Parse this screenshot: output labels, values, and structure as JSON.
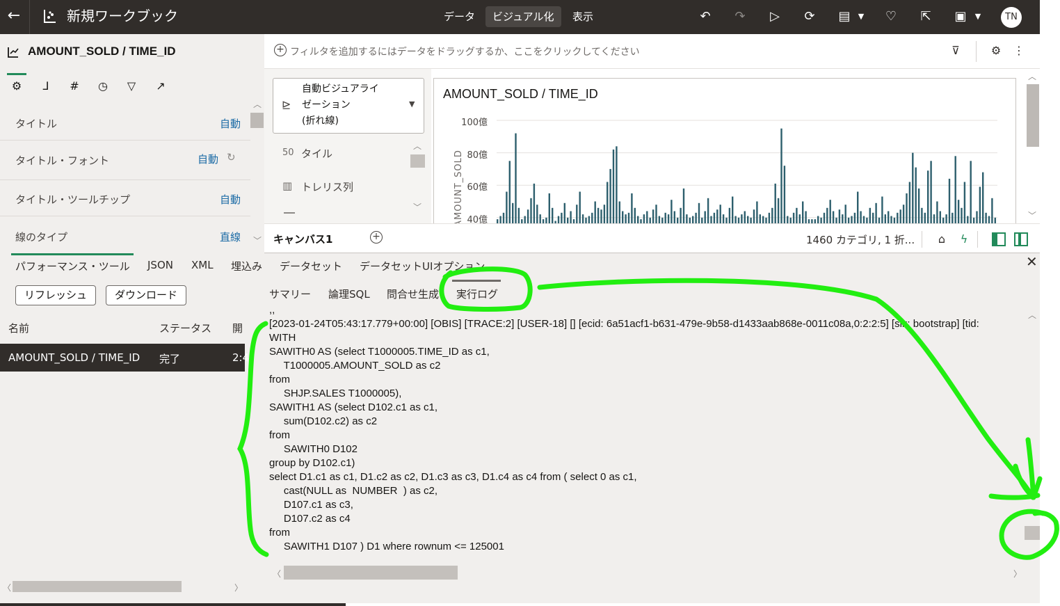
{
  "header": {
    "back_icon": "back-arrow-icon",
    "workbook_title": "新規ワークブック",
    "tabs": [
      {
        "label": "データ",
        "active": false
      },
      {
        "label": "ビジュアル化",
        "active": true
      },
      {
        "label": "表示",
        "active": false
      }
    ],
    "avatar_initials": "TN"
  },
  "properties": {
    "viz_title": "AMOUNT_SOLD / TIME_ID",
    "rows": [
      {
        "label": "タイトル",
        "value": "自動"
      },
      {
        "label": "タイトル・フォント",
        "value": "自動"
      },
      {
        "label": "タイトル・ツールチップ",
        "value": "自動"
      },
      {
        "label": "線のタイプ",
        "value": "直線"
      }
    ]
  },
  "filterbar": {
    "hint": "フィルタを追加するにはデータをドラッグするか、ここをクリックしてください"
  },
  "grammar": {
    "viz_type_line1": "自動ビジュアライ",
    "viz_type_line2": "ゼーション",
    "viz_type_line3": "(折れ線)",
    "items": [
      {
        "icon_text": "50",
        "label": "タイル"
      },
      {
        "icon_text": "▥",
        "label": "トレリス列"
      }
    ]
  },
  "chart_data": {
    "type": "bar",
    "title": "AMOUNT_SOLD / TIME_ID",
    "ylabel": "AMOUNT_SOLD",
    "y_ticks": [
      "100億",
      "80億",
      "60億",
      "40億"
    ],
    "y_tick_values": [
      10000000000,
      8000000000,
      6000000000,
      4000000000
    ],
    "ylim_visible": [
      3700000000,
      10600000000
    ],
    "color": "#2d5f6d",
    "values_billion": [
      3.9,
      4.1,
      4.3,
      5.6,
      7.5,
      4.9,
      9.2,
      4.6,
      3.9,
      4.1,
      4.5,
      5.2,
      6.1,
      4.8,
      4.2,
      3.9,
      4.0,
      5.5,
      4.6,
      3.8,
      4.1,
      4.3,
      4.9,
      4.0,
      4.4,
      3.9,
      4.8,
      5.6,
      4.2,
      4.0,
      4.1,
      4.3,
      5.0,
      4.6,
      4.5,
      4.8,
      6.2,
      7.0,
      8.2,
      8.4,
      5.0,
      4.4,
      4.2,
      4.3,
      5.5,
      4.6,
      4.1,
      3.9,
      4.2,
      4.4,
      4.0,
      4.5,
      4.8,
      4.1,
      4.0,
      4.3,
      4.2,
      5.1,
      4.4,
      4.0,
      4.6,
      5.8,
      4.2,
      4.0,
      4.1,
      4.3,
      4.9,
      4.0,
      4.4,
      5.2,
      4.1,
      4.3,
      4.5,
      4.8,
      4.2,
      4.0,
      4.6,
      5.3,
      4.1,
      4.0,
      4.2,
      4.4,
      4.1,
      4.0,
      4.5,
      5.0,
      4.2,
      4.1,
      4.0,
      4.3,
      4.6,
      6.1,
      5.2,
      9.5,
      7.2,
      4.1,
      4.0,
      4.3,
      4.6,
      4.2,
      5.0,
      4.4,
      3.9,
      3.9,
      3.9,
      4.1,
      4.0,
      4.3,
      4.6,
      5.1,
      4.4,
      4.0,
      4.5,
      4.2,
      4.8,
      4.0,
      4.1,
      4.3,
      5.6,
      4.4,
      4.1,
      4.0,
      4.6,
      4.3,
      4.9,
      4.0,
      5.3,
      4.2,
      4.4,
      4.1,
      4.0,
      4.3,
      4.5,
      4.8,
      5.5,
      6.2,
      8.0,
      7.1,
      5.8,
      4.6,
      4.3,
      6.9,
      7.5,
      4.2,
      5.0,
      4.4,
      4.0,
      4.2,
      6.4,
      4.3,
      7.8,
      5.1,
      4.6,
      6.2,
      4.1,
      7.5,
      4.0,
      4.4,
      5.9,
      6.8,
      4.3,
      4.1,
      5.2,
      4.0
    ]
  },
  "canvasbar": {
    "canvas_tab": "キャンバス1",
    "status": "1460 カテゴリ, 1 折..."
  },
  "bottom": {
    "tabs": [
      "パフォーマンス・ツール",
      "JSON",
      "XML",
      "埋込み",
      "データセット",
      "データセットUIオプション"
    ],
    "refresh_label": "リフレッシュ",
    "download_label": "ダウンロード",
    "columns": [
      "名前",
      "ステータス",
      "開"
    ],
    "row": {
      "name": "AMOUNT_SOLD / TIME_ID",
      "status": "完了",
      "start": "2:4"
    },
    "subtabs": [
      "サマリー",
      "論理SQL",
      "問合せ生成",
      "実行ログ"
    ],
    "log_lines": [
      ",,",
      "[2023-01-24T05:43:17.779+00:00] [OBIS] [TRACE:2] [USER-18] [] [ecid: 6a51acf1-b631-479e-9b58-d1433aab868e-0011c08a,0:2:2:5] [sik: bootstrap] [tid:",
      "WITH",
      "SAWITH0 AS (select T1000005.TIME_ID as c1,",
      "     T1000005.AMOUNT_SOLD as c2",
      "from",
      "     SHJP.SALES T1000005),",
      "SAWITH1 AS (select D102.c1 as c1,",
      "     sum(D102.c2) as c2",
      "from",
      "     SAWITH0 D102",
      "group by D102.c1)",
      "select D1.c1 as c1, D1.c2 as c2, D1.c3 as c3, D1.c4 as c4 from ( select 0 as c1,",
      "     cast(NULL as  NUMBER  ) as c2,",
      "     D107.c1 as c3,",
      "     D107.c2 as c4",
      "from",
      "     SAWITH1 D107 ) D1 where rownum <= 125001",
      "",
      "--"
    ]
  },
  "annotation_color": "#22ee11"
}
